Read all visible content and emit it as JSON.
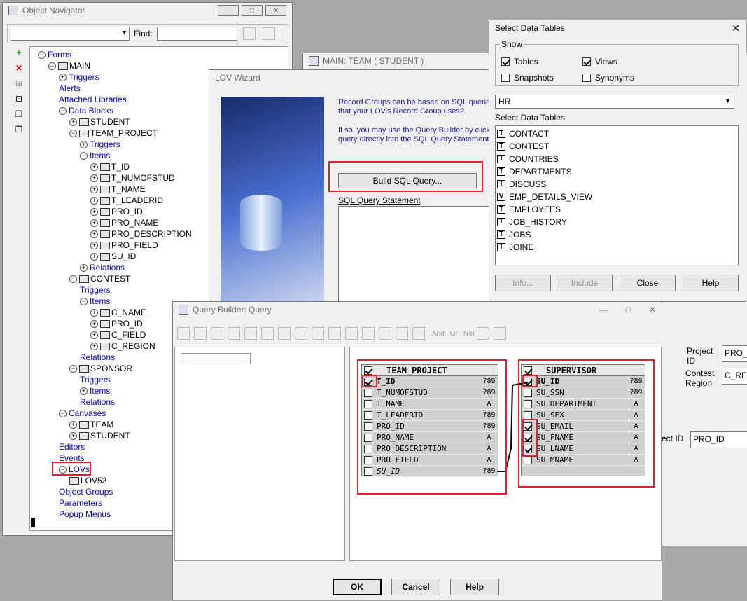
{
  "object_navigator": {
    "title": "Object Navigator",
    "find_label": "Find:",
    "tree": [
      {
        "label": "Forms",
        "level": 0,
        "expander": "−",
        "blue": true
      },
      {
        "label": "MAIN",
        "level": 1,
        "expander": "−",
        "icon": true
      },
      {
        "label": "Triggers",
        "level": 2,
        "expander": "+",
        "blue": true
      },
      {
        "label": "Alerts",
        "level": 2,
        "blue": true
      },
      {
        "label": "Attached Libraries",
        "level": 2,
        "blue": true
      },
      {
        "label": "Data Blocks",
        "level": 2,
        "expander": "−",
        "blue": true
      },
      {
        "label": "STUDENT",
        "level": 3,
        "expander": "+",
        "icon": true
      },
      {
        "label": "TEAM_PROJECT",
        "level": 3,
        "expander": "−",
        "icon": true
      },
      {
        "label": "Triggers",
        "level": 4,
        "expander": "+",
        "blue": true
      },
      {
        "label": "Items",
        "level": 4,
        "expander": "−",
        "blue": true
      },
      {
        "label": "T_ID",
        "level": 5,
        "expander": "+",
        "icon": true
      },
      {
        "label": "T_NUMOFSTUD",
        "level": 5,
        "expander": "+",
        "icon": true
      },
      {
        "label": "T_NAME",
        "level": 5,
        "expander": "+",
        "icon": true
      },
      {
        "label": "T_LEADERID",
        "level": 5,
        "expander": "+",
        "icon": true
      },
      {
        "label": "PRO_ID",
        "level": 5,
        "expander": "+",
        "icon": true
      },
      {
        "label": "PRO_NAME",
        "level": 5,
        "expander": "+",
        "icon": true
      },
      {
        "label": "PRO_DESCRIPTION",
        "level": 5,
        "expander": "+",
        "icon": true
      },
      {
        "label": "PRO_FIELD",
        "level": 5,
        "expander": "+",
        "icon": true
      },
      {
        "label": "SU_ID",
        "level": 5,
        "expander": "+",
        "icon": true
      },
      {
        "label": "Relations",
        "level": 4,
        "expander": "+",
        "blue": true
      },
      {
        "label": "CONTEST",
        "level": 3,
        "expander": "−",
        "icon": true
      },
      {
        "label": "Triggers",
        "level": 4,
        "blue": true
      },
      {
        "label": "Items",
        "level": 4,
        "expander": "−",
        "blue": true
      },
      {
        "label": "C_NAME",
        "level": 5,
        "expander": "+",
        "icon": true
      },
      {
        "label": "PRO_ID",
        "level": 5,
        "expander": "+",
        "icon": true
      },
      {
        "label": "C_FIELD",
        "level": 5,
        "expander": "+",
        "icon": true
      },
      {
        "label": "C_REGION",
        "level": 5,
        "expander": "+",
        "icon": true
      },
      {
        "label": "Relations",
        "level": 4,
        "blue": true
      },
      {
        "label": "SPONSOR",
        "level": 3,
        "expander": "−",
        "icon": true
      },
      {
        "label": "Triggers",
        "level": 4,
        "blue": true
      },
      {
        "label": "Items",
        "level": 4,
        "expander": "+",
        "blue": true
      },
      {
        "label": "Relations",
        "level": 4,
        "blue": true
      },
      {
        "label": "Canvases",
        "level": 2,
        "expander": "−",
        "blue": true
      },
      {
        "label": "TEAM",
        "level": 3,
        "expander": "+",
        "icon": true
      },
      {
        "label": "STUDENT",
        "level": 3,
        "expander": "+",
        "icon": true
      },
      {
        "label": "Editors",
        "level": 2,
        "blue": true
      },
      {
        "label": "Events",
        "level": 2,
        "blue": true
      },
      {
        "label": "LOVs",
        "level": 2,
        "expander": "−",
        "blue": true
      },
      {
        "label": "LOV52",
        "level": 3,
        "icon": true
      },
      {
        "label": "Object Groups",
        "level": 2,
        "blue": true
      },
      {
        "label": "Parameters",
        "level": 2,
        "blue": true
      },
      {
        "label": "Popup Menus",
        "level": 2,
        "blue": true
      }
    ]
  },
  "main_team": {
    "title": "MAIN: TEAM ( STUDENT )",
    "labels": [
      "Project ID",
      "Contest Region",
      "ect ID"
    ],
    "fields": [
      "PRO_ID",
      "C_REG",
      "PRO_ID"
    ]
  },
  "lov_wizard": {
    "title": "LOV Wizard",
    "text1": "Record Groups can be based on SQL queries",
    "text1b": "that your LOV's Record Group uses?",
    "text2": "If so, you may use the Query Builder by clickin",
    "text2b": "query directly into the SQL Query Statement fi",
    "build_button": "Build SQL Query...",
    "sql_label": "SQL Query Statement"
  },
  "select_tables": {
    "title": "Select Data Tables",
    "show_label": "Show",
    "tables": "Tables",
    "views": "Views",
    "snapshots": "Snapshots",
    "synonyms": "Synonyms",
    "schema": "HR",
    "list_label": "Select Data Tables",
    "items": [
      {
        "n": "CONTACT",
        "t": "T"
      },
      {
        "n": "CONTEST",
        "t": "T"
      },
      {
        "n": "COUNTRIES",
        "t": "T"
      },
      {
        "n": "DEPARTMENTS",
        "t": "T"
      },
      {
        "n": "DISCUSS",
        "t": "T"
      },
      {
        "n": "EMP_DETAILS_VIEW",
        "t": "V"
      },
      {
        "n": "EMPLOYEES",
        "t": "T"
      },
      {
        "n": "JOB_HISTORY",
        "t": "T"
      },
      {
        "n": "JOBS",
        "t": "T"
      },
      {
        "n": "JOINE",
        "t": "T"
      }
    ],
    "info": "Info...",
    "include": "Include",
    "close": "Close",
    "help": "Help"
  },
  "query_builder": {
    "title": "Query Builder: Query",
    "toolbar_text": [
      "And",
      "Or",
      "Not"
    ],
    "team_table": {
      "name": "TEAM_PROJECT",
      "rows": [
        {
          "n": "T_ID",
          "c": true,
          "ty": "?89",
          "b": true
        },
        {
          "n": "T_NUMOFSTUD",
          "c": false,
          "ty": "?89"
        },
        {
          "n": "T_NAME",
          "c": false,
          "ty": "A"
        },
        {
          "n": "T_LEADERID",
          "c": false,
          "ty": "?89"
        },
        {
          "n": "PRO_ID",
          "c": false,
          "ty": "?89"
        },
        {
          "n": "PRO_NAME",
          "c": false,
          "ty": "A"
        },
        {
          "n": "PRO_DESCRIPTION",
          "c": false,
          "ty": "A"
        },
        {
          "n": "PRO_FIELD",
          "c": false,
          "ty": "A"
        },
        {
          "n": "SU_ID",
          "c": false,
          "ty": "?89",
          "i": true
        }
      ]
    },
    "sup_table": {
      "name": "SUPERVISOR",
      "rows": [
        {
          "n": "SU_ID",
          "c": true,
          "ty": "?89",
          "b": true
        },
        {
          "n": "SU_SSN",
          "c": false,
          "ty": "?89"
        },
        {
          "n": "SU_DEPARTMENT",
          "c": false,
          "ty": "A"
        },
        {
          "n": "SU_SEX",
          "c": false,
          "ty": "A"
        },
        {
          "n": "SU_EMAIL",
          "c": true,
          "ty": "A"
        },
        {
          "n": "SU_FNAME",
          "c": true,
          "ty": "A"
        },
        {
          "n": "SU_LNAME",
          "c": true,
          "ty": "A"
        },
        {
          "n": "SU_MNAME",
          "c": false,
          "ty": "A"
        }
      ]
    },
    "ok": "OK",
    "cancel": "Cancel",
    "help": "Help"
  }
}
